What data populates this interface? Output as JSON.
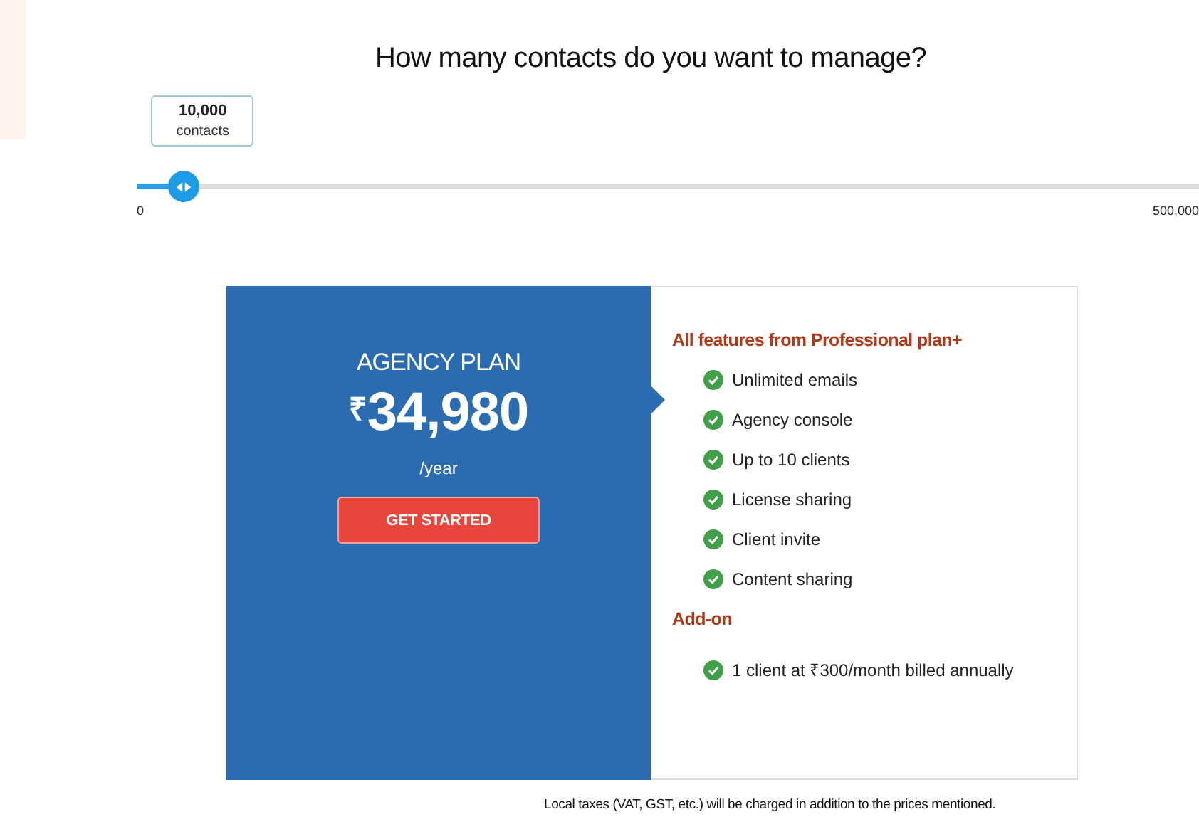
{
  "heading": "How many contacts do you want to manage?",
  "slider": {
    "tooltip_value": "10,000",
    "tooltip_unit": "contacts",
    "level": 0.03,
    "min_label": "0",
    "max_label": "500,000"
  },
  "plan": {
    "name": "AGENCY PLAN",
    "currency": "₹",
    "price": "34,980",
    "period": "/year",
    "button": "GET STARTED"
  },
  "features": {
    "heading": "All features from Professional plan+",
    "items": [
      {
        "text": "Unlimited emails",
        "included": true
      },
      {
        "text": "Agency console",
        "included": true
      },
      {
        "text": "Up to 10 clients",
        "included": true
      },
      {
        "text": "License sharing",
        "included": true
      },
      {
        "text": "Client invite",
        "included": true
      },
      {
        "text": "Content sharing",
        "included": true
      }
    ]
  },
  "addon": {
    "heading": "Add-on",
    "items": [
      {
        "text": "1 client at ₹300/month billed annually",
        "included": true
      }
    ]
  },
  "footnote": "Local taxes (VAT, GST, etc.) will be charged in addition to the prices mentioned."
}
